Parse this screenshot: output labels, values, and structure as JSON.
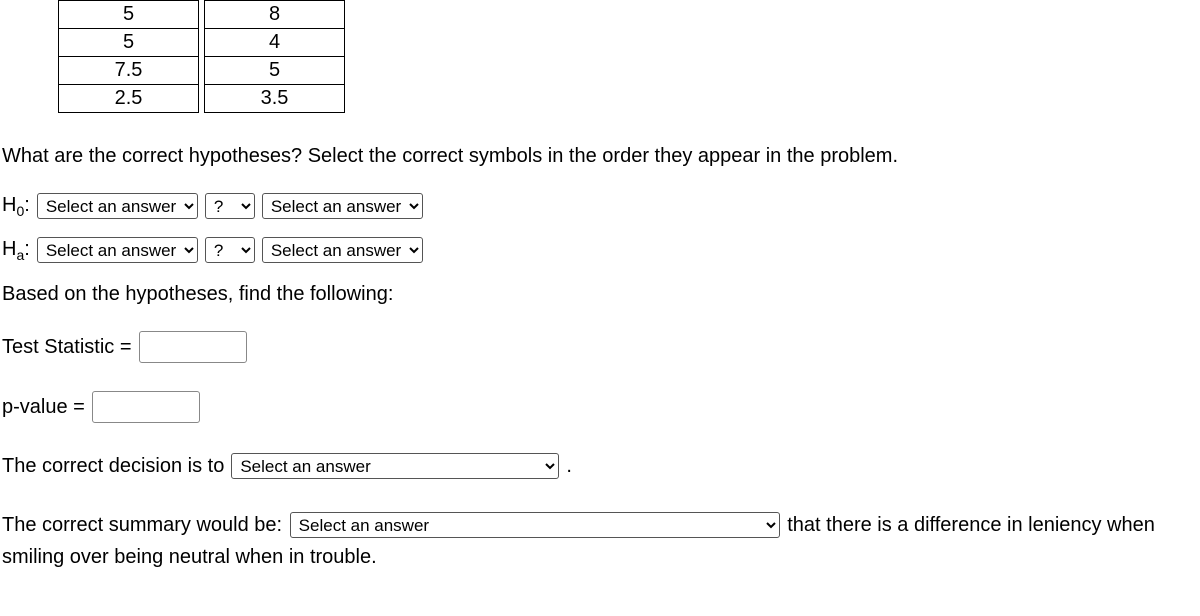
{
  "table": {
    "rows": [
      [
        "5",
        "8"
      ],
      [
        "5",
        "4"
      ],
      [
        "7.5",
        "5"
      ],
      [
        "2.5",
        "3.5"
      ]
    ]
  },
  "q1": "What are the correct hypotheses? Select the correct symbols in the order they appear in the problem.",
  "h0_label": "H",
  "h0_sub": "0",
  "ha_label": "H",
  "ha_sub": "a",
  "colon": ":",
  "select_answer_placeholder": "Select an answer",
  "qmark_placeholder": "?",
  "based_on": "Based on the hypotheses, find the following:",
  "test_stat_label": "Test Statistic =",
  "pvalue_label": "p-value =",
  "decision_prefix": "The correct decision is to",
  "decision_suffix": ".",
  "summary_prefix": "The correct summary would be:",
  "summary_suffix": "that there is a difference in leniency when smiling over being neutral when in trouble."
}
